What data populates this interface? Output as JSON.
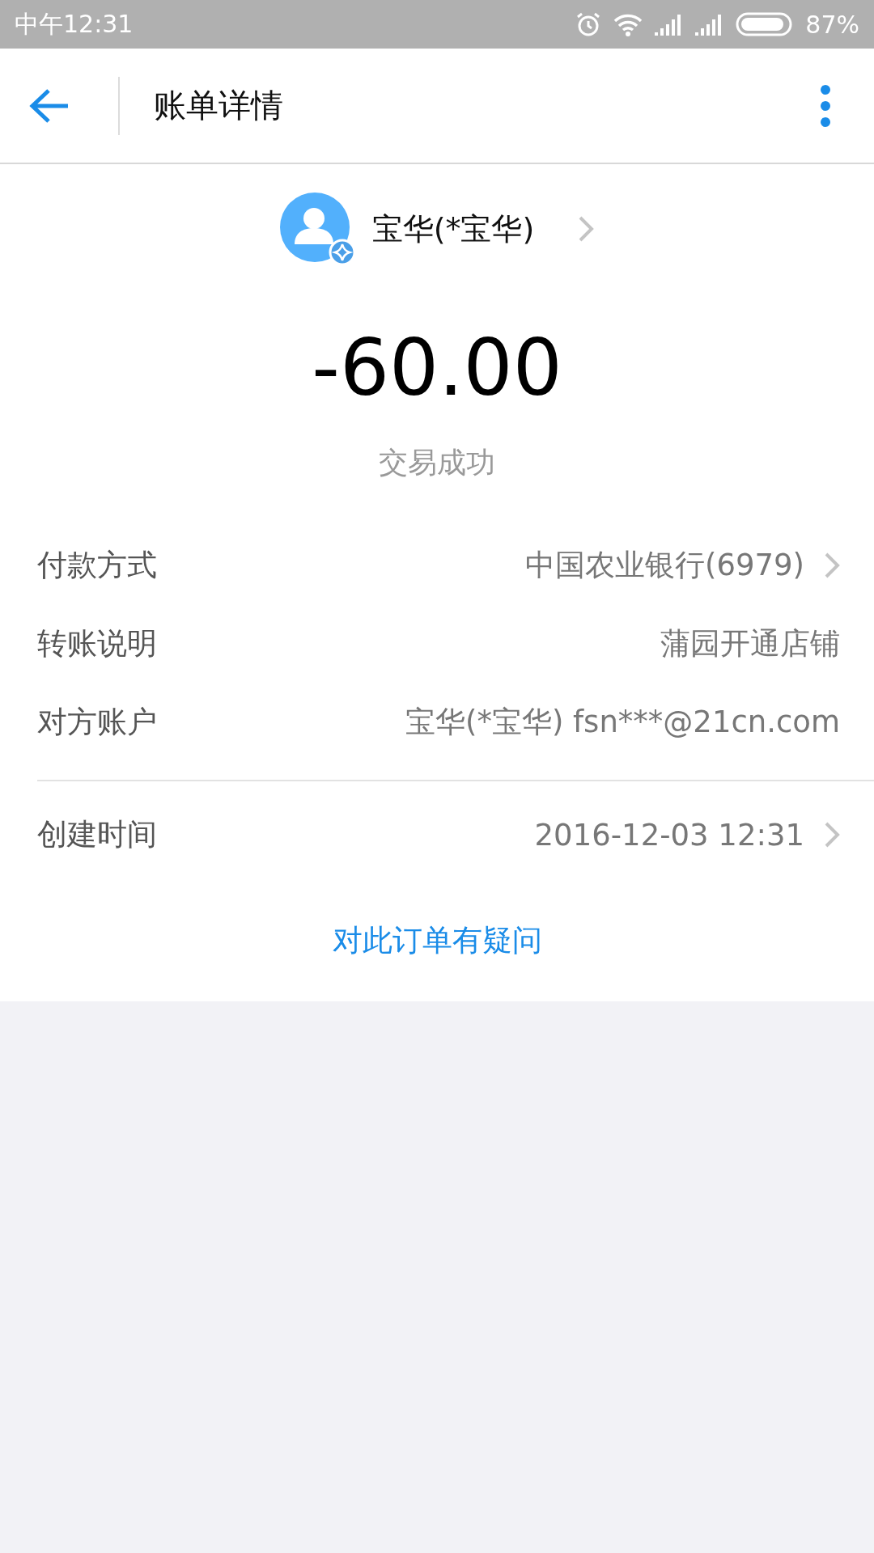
{
  "status_bar": {
    "time": "中午12:31",
    "battery": "87%"
  },
  "header": {
    "title": "账单详情"
  },
  "payee": {
    "name": "宝华(*宝华)"
  },
  "amount": "-60.00",
  "status": "交易成功",
  "sections": [
    {
      "rows": [
        {
          "label": "付款方式",
          "value": "中国农业银行(6979)",
          "chevron": true
        },
        {
          "label": "转账说明",
          "value": "蒲园开通店铺",
          "chevron": false
        },
        {
          "label": "对方账户",
          "value": "宝华(*宝华) fsn***@21cn.com",
          "chevron": false
        }
      ]
    },
    {
      "rows": [
        {
          "label": "创建时间",
          "value": "2016-12-03 12:31",
          "chevron": true
        }
      ]
    }
  ],
  "question_link": "对此订单有疑问"
}
